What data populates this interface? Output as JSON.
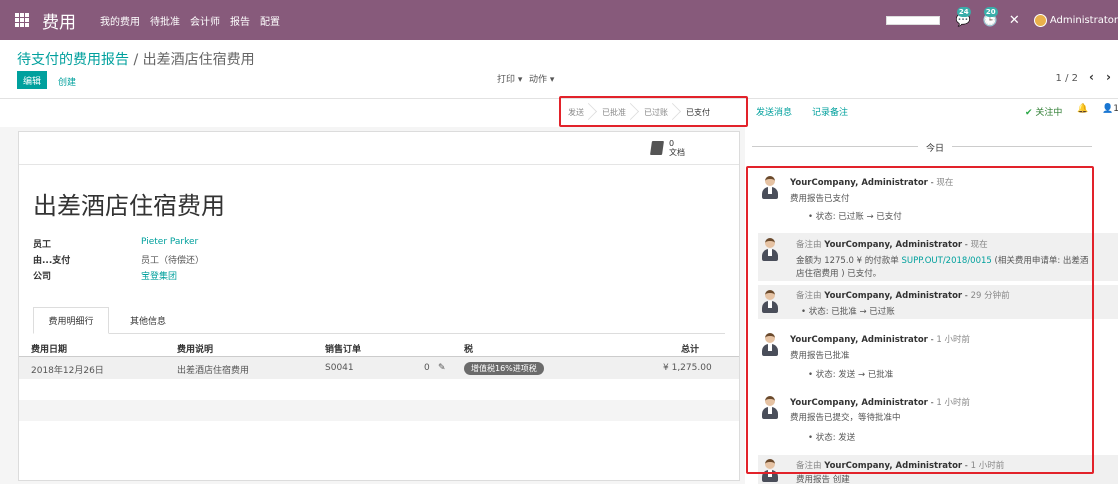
{
  "navbar": {
    "brand": "费用",
    "menu": [
      "我的费用",
      "待批准",
      "会计师",
      "报告",
      "配置"
    ],
    "chat_count": "24",
    "activity_count": "20",
    "user": "Administrator"
  },
  "breadcrumb": {
    "parent": "待支付的费用报告",
    "sep": " / ",
    "current": "出差酒店住宿费用"
  },
  "buttons": {
    "edit": "编辑",
    "create": "创建",
    "print": "打印 ▾",
    "action": "动作 ▾"
  },
  "pager": {
    "text": "1 / 2"
  },
  "status": {
    "stages": [
      "发送",
      "已批准",
      "已过账",
      "已支付"
    ],
    "current": "已支付"
  },
  "chatter_top": {
    "send_message": "发送消息",
    "log_note": "记录备注",
    "following": "关注中",
    "followers": "1"
  },
  "sheet": {
    "doc_count": "0",
    "doc_label": "文档",
    "title": "出差酒店住宿费用",
    "fields": [
      {
        "label": "员工",
        "value": "Pieter Parker",
        "link": true
      },
      {
        "label": "由...支付",
        "value": "员工（待偿还）",
        "link": false
      },
      {
        "label": "公司",
        "value": "宝登集团",
        "link": true
      }
    ],
    "tabs": [
      "费用明细行",
      "其他信息"
    ],
    "columns": [
      "费用日期",
      "费用说明",
      "销售订单",
      "税",
      "总计"
    ],
    "rows": [
      {
        "date": "2018年12月26日",
        "desc": "出差酒店住宿费用",
        "so": "S0041",
        "attach": "0",
        "tax": "增值税16%进项税",
        "total": "¥ 1,275.00"
      }
    ]
  },
  "chatter": {
    "today": "今日",
    "messages": [
      {
        "author": "YourCompany, Administrator",
        "time": "现在",
        "text": "费用报告已支付",
        "bullet": "状态: 已过账 → 已支付",
        "note": false
      },
      {
        "author": "YourCompany, Administrator",
        "time": "现在",
        "note_prefix": "备注由",
        "text1_pre": "金额为 1275.0 ¥ 的付款单 ",
        "text1_link": "SUPP.OUT/2018/0015",
        "text1_post": " (相关费用申请单:  出差酒",
        "text2": "店住宿费用 ) 已支付。",
        "note": true
      },
      {
        "author": "YourCompany, Administrator",
        "time": "29 分钟前",
        "note_prefix": "备注由",
        "bullet": "状态: 已批准 → 已过账",
        "note": true
      },
      {
        "author": "YourCompany, Administrator",
        "time": "1 小时前",
        "text": "费用报告已批准",
        "bullet": "状态: 发送 → 已批准",
        "note": false
      },
      {
        "author": "YourCompany, Administrator",
        "time": "1 小时前",
        "text": "费用报告已提交，等待批准中",
        "bullet": "状态: 发送",
        "note": false
      },
      {
        "author": "YourCompany, Administrator",
        "time": "1 小时前",
        "note_prefix": "备注由",
        "text": "费用报告 创建",
        "note": true
      }
    ]
  },
  "colors": {
    "brand": "#875a7b",
    "accent": "#00a09d",
    "highlight": "#e2222a"
  }
}
